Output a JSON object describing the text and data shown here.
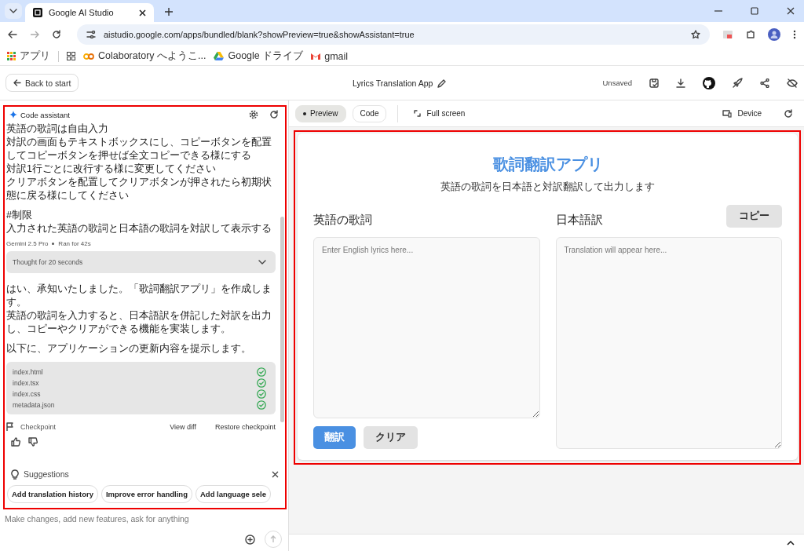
{
  "browser": {
    "tab_title": "Google AI Studio",
    "url": "aistudio.google.com/apps/bundled/blank?showPreview=true&showAssistant=true",
    "bookmarks": [
      {
        "kind": "apps",
        "label": "アプリ"
      },
      {
        "kind": "grid"
      },
      {
        "kind": "colab",
        "label": "Colaboratory へようこ..."
      },
      {
        "kind": "drive",
        "label": "Google ドライブ"
      },
      {
        "kind": "gmail",
        "label": "gmail"
      }
    ]
  },
  "header": {
    "back_button": "Back to start",
    "title": "Lyrics Translation App",
    "status": "Unsaved"
  },
  "assistant": {
    "title": "Code assistant",
    "prompt_paragraphs": [
      [
        "英語の歌詞は自由入力",
        "対訳の画面もテキストボックスにし、コピーボタンを配置してコピーボタンを押せば全文コピーできる様にする",
        "対訳1行ごとに改行する様に変更してください",
        "クリアボタンを配置してクリアボタンが押されたら初期状態に戻る様にしてください"
      ],
      [
        "#制限",
        "入力された英語の歌詞と日本語の歌詞を対訳して表示する"
      ]
    ],
    "model": "Gemini 2.5 Pro",
    "run_time": "Ran for 42s",
    "thought": "Thought for 20 seconds",
    "thought_expanded": false,
    "reply_paragraphs": [
      [
        "はい、承知いたしました。「歌詞翻訳アプリ」を作成します。",
        "英語の歌詞を入力すると、日本語訳を併記した対訳を出力し、コピーやクリアができる機能を実装します。"
      ],
      [
        "以下に、アプリケーションの更新内容を提示します。"
      ]
    ],
    "files": [
      {
        "name": "index.html",
        "done": true
      },
      {
        "name": "index.tsx",
        "done": true
      },
      {
        "name": "index.css",
        "done": true
      },
      {
        "name": "metadata.json",
        "done": true
      }
    ],
    "checkpoint": "Checkpoint",
    "view_diff": "View diff",
    "restore": "Restore checkpoint",
    "suggestions_title": "Suggestions",
    "suggestions": [
      "Add translation history",
      "Improve error handling",
      "Add language sele"
    ],
    "input_placeholder": "Make changes, add new features, ask for anything"
  },
  "preview_bar": {
    "tabs": [
      {
        "label": "Preview",
        "selected": true
      },
      {
        "label": "Code",
        "selected": false
      }
    ],
    "full_screen": "Full screen",
    "device": "Device"
  },
  "app": {
    "title": "歌詞翻訳アプリ",
    "subtitle": "英語の歌詞を日本語と対訳翻訳して出力します",
    "input_label": "英語の歌詞",
    "input_placeholder": "Enter English lyrics here...",
    "output_label": "日本語訳",
    "copy_button": "コピー",
    "output_placeholder": "Translation will appear here...",
    "translate_button": "翻訳",
    "clear_button": "クリア"
  }
}
